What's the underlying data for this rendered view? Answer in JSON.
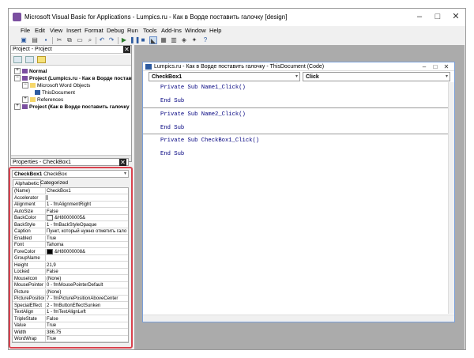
{
  "app": {
    "title": "Microsoft Visual Basic for Applications - Lumpics.ru - Как в Ворде поставить галочку [design]"
  },
  "menu": [
    "File",
    "Edit",
    "View",
    "Insert",
    "Format",
    "Debug",
    "Run",
    "Tools",
    "Add-Ins",
    "Window",
    "Help"
  ],
  "project": {
    "title": "Project - Project",
    "tree": [
      {
        "label": "Normal",
        "bold": true
      },
      {
        "label": "Project (Lumpics.ru - Как в Ворде постав",
        "bold": true
      },
      {
        "label": "Microsoft Word Objects",
        "bold": false
      },
      {
        "label": "ThisDocument",
        "bold": false
      },
      {
        "label": "References",
        "bold": false
      },
      {
        "label": "Project (Как в Ворде поставить галочку",
        "bold": true
      }
    ]
  },
  "properties": {
    "title": "Properties - CheckBox1",
    "object_name": "CheckBox1",
    "object_type": "CheckBox",
    "tabs": [
      "Alphabetic",
      "Categorized"
    ],
    "rows": [
      {
        "name": "(Name)",
        "value": "CheckBox1"
      },
      {
        "name": "Accelerator",
        "value": ""
      },
      {
        "name": "Alignment",
        "value": "1 - fmAlignmentRight"
      },
      {
        "name": "AutoSize",
        "value": "False"
      },
      {
        "name": "BackColor",
        "value": "&H80000005&",
        "swatch": "#ffffff"
      },
      {
        "name": "BackStyle",
        "value": "1 - fmBackStyleOpaque"
      },
      {
        "name": "Caption",
        "value": "Пункт, который нужно отметить гало"
      },
      {
        "name": "Enabled",
        "value": "True"
      },
      {
        "name": "Font",
        "value": "Tahoma"
      },
      {
        "name": "ForeColor",
        "value": "&H80000008&",
        "swatch": "#000000"
      },
      {
        "name": "GroupName",
        "value": ""
      },
      {
        "name": "Height",
        "value": "21,9"
      },
      {
        "name": "Locked",
        "value": "False"
      },
      {
        "name": "MouseIcon",
        "value": "(None)"
      },
      {
        "name": "MousePointer",
        "value": "0 - fmMousePointerDefault"
      },
      {
        "name": "Picture",
        "value": "(None)"
      },
      {
        "name": "PicturePosition",
        "value": "7 - fmPicturePositionAboveCenter"
      },
      {
        "name": "SpecialEffect",
        "value": "2 - fmButtonEffectSunken"
      },
      {
        "name": "TextAlign",
        "value": "1 - fmTextAlignLeft"
      },
      {
        "name": "TripleState",
        "value": "False"
      },
      {
        "name": "Value",
        "value": "True"
      },
      {
        "name": "Width",
        "value": "386,75"
      },
      {
        "name": "WordWrap",
        "value": "True"
      }
    ]
  },
  "code_window": {
    "title": "Lumpics.ru - Как в Ворде поставить галочку - ThisDocument (Code)",
    "object_dropdown": "CheckBox1",
    "proc_dropdown": "Click",
    "procedures": [
      {
        "sub": "Private Sub Name1_Click()",
        "end": "End Sub"
      },
      {
        "sub": "Private Sub Name2_Click()",
        "end": "End Sub"
      },
      {
        "sub": "Private Sub CheckBox1_Click()",
        "end": "End Sub"
      }
    ]
  },
  "colors": {
    "highlight_frame": "#d9424e",
    "keyword": "#00007f",
    "mdi_background": "#ababab"
  }
}
